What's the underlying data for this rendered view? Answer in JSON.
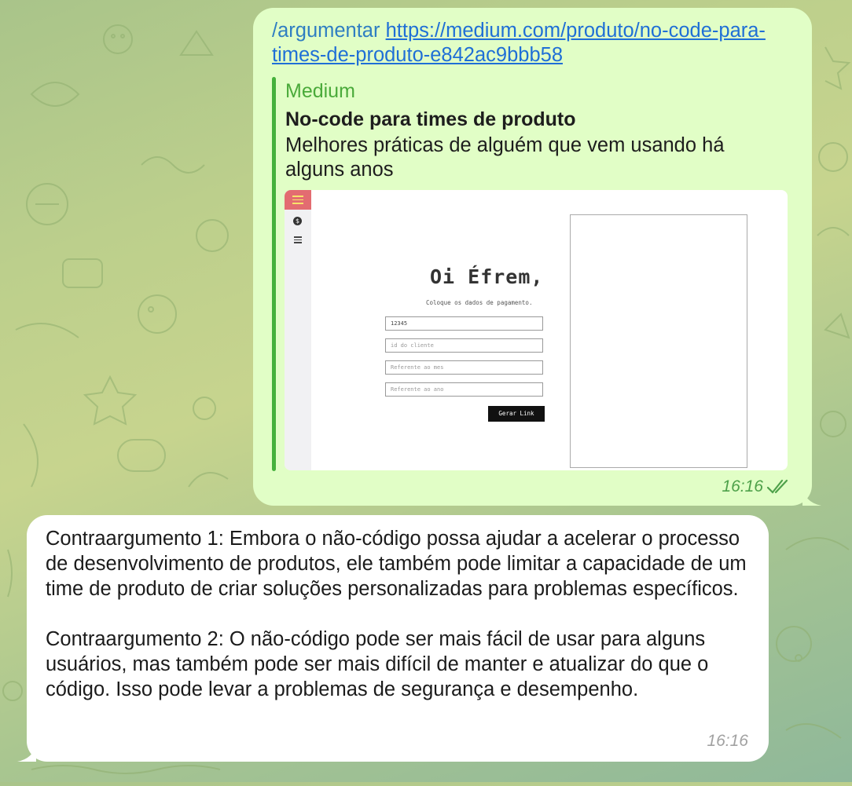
{
  "chat": {
    "outgoing": {
      "command": "/argumentar",
      "url": "https://medium.com/produto/no-code-para-times-de-produto-e842ac9bbb58",
      "time": "16:16",
      "status_icon": "double-check-icon",
      "preview": {
        "site_name": "Medium",
        "title": "No-code para times de produto",
        "description": "Melhores práticas de alguém que vem usando há alguns anos",
        "image": {
          "greeting": "Oi Éfrem,",
          "subtitle": "Coloque os dados de pagamento.",
          "inputs": [
            {
              "value": "12345",
              "placeholder": ""
            },
            {
              "value": "",
              "placeholder": "id do cliente"
            },
            {
              "value": "",
              "placeholder": "Referente ao mes"
            },
            {
              "value": "",
              "placeholder": "Referente ao ano"
            }
          ],
          "button_label": "Gerar Link",
          "sidebar_icons": [
            "menu-icon",
            "dollar-icon",
            "list-icon"
          ]
        }
      }
    },
    "incoming": {
      "paragraphs": [
        "Contraargumento 1: Embora o não-código possa ajudar a acelerar o processo de desenvolvimento de produtos, ele também pode limitar a capacidade de um time de produto de criar soluções personalizadas para problemas específicos.",
        "Contraargumento 2: O não-código pode ser mais fácil de usar para alguns usuários, mas também pode ser mais difícil de manter e atualizar do que o código. Isso pode levar a problemas de segurança e desempenho."
      ],
      "time": "16:16"
    }
  },
  "colors": {
    "outgoing_bubble": "#e1fec6",
    "incoming_bubble": "#ffffff",
    "accent_green": "#45b13c",
    "link_blue": "#1f6fd6",
    "button_red": "#e36c71"
  }
}
